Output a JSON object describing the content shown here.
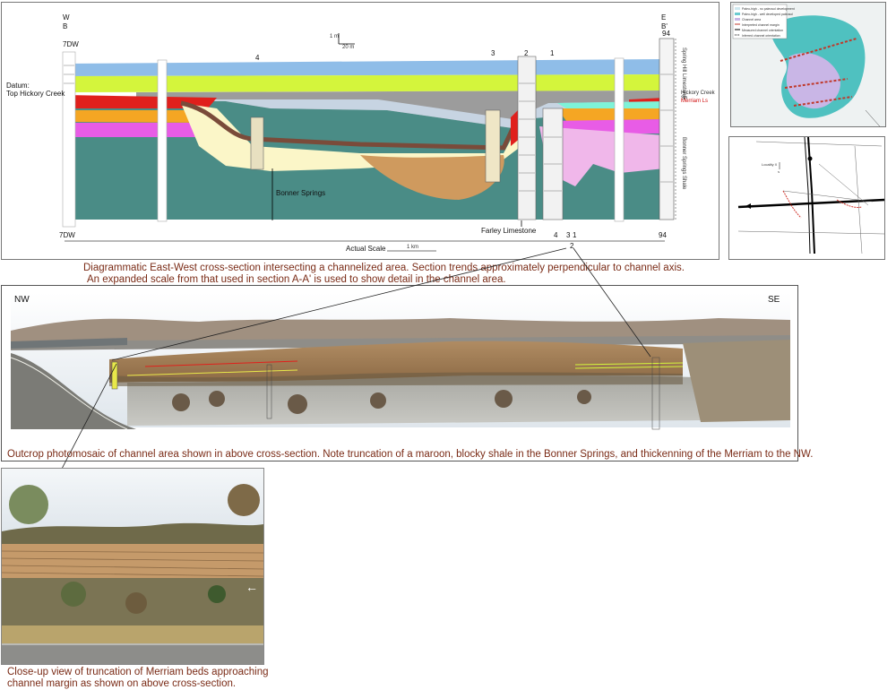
{
  "cross_section": {
    "west_label_1": "W",
    "west_label_2": "B",
    "east_label_1": "E",
    "east_label_2": "B'",
    "west_well": "7DW",
    "east_well": "94",
    "datum_1": "Datum:",
    "datum_2": "Top Hickory Creek",
    "scale_vertical": "1 m",
    "scale_horizontal": "20 m",
    "well_labels": [
      "4",
      "3",
      "2",
      "1"
    ],
    "unit_labels": {
      "bonner": "Bonner Springs",
      "farley": "Farley Limestone"
    },
    "right_unit_labels": [
      "Spring Hill Limestone",
      "Hickory Creek Sh",
      "Merriam Ls",
      "Bonner Springs Shale"
    ],
    "bottom_wells": {
      "left": "7DW",
      "middle": "4",
      "mid_a": "3",
      "mid_b": "1",
      "mid_c": "2",
      "right": "94"
    },
    "actual_scale": "Actual Scale",
    "actual_scale_unit": "1 km"
  },
  "captions": {
    "cross_section_1": "Diagrammatic East-West cross-section intersecting a channelized area.  Section trends approximately perpendicular to channel axis.",
    "cross_section_2": "An expanded scale from that used in section A-A' is used to show detail in the channel area.",
    "photomosaic": "Outcrop photomosaic of channel area shown in above cross-section.  Note truncation of a maroon, blocky shale in the Bonner Springs, and thickenning of the Merriam to the NW.",
    "closeup_1": "Close-up view of truncation of Merriam beds approaching",
    "closeup_2": "channel margin as shown on above cross-section."
  },
  "photo": {
    "nw": "NW",
    "se": "SE"
  },
  "map": {
    "legend": [
      "Paleo-high - no paleosol development",
      "Paleo-high - well developed paleosol",
      "Channel area",
      "Interpreted channel margin",
      "Measured channel orientation",
      "Inferred channel orientation"
    ],
    "locality": "Locality X"
  },
  "colors": {
    "blue": "#8fbde8",
    "yellow_green": "#d4f53c",
    "gray": "#9c9c9c",
    "red": "#e0201c",
    "orange": "#f5a623",
    "magenta": "#e85ce6",
    "teal": "#4a8c86",
    "cream": "#fbf6c8",
    "brown": "#7a4b3a",
    "tan": "#cf9a5e",
    "pink": "#f0b7ea",
    "caption": "#7a2b16"
  }
}
